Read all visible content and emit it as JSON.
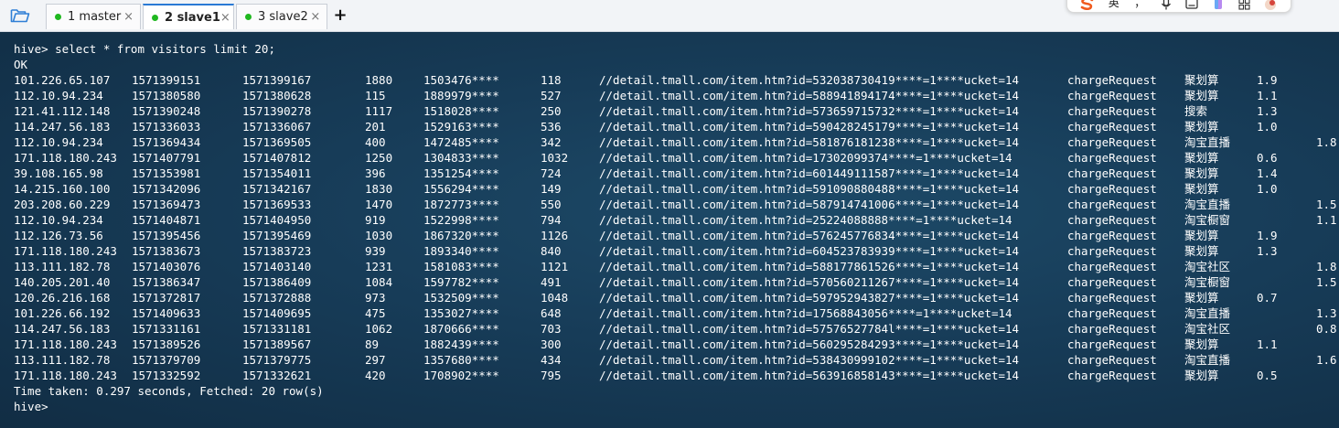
{
  "tabs": [
    {
      "label": "1 master",
      "active": false
    },
    {
      "label": "2 slave1",
      "active": true
    },
    {
      "label": "3 slave2",
      "active": false
    }
  ],
  "tab_close_glyph": "×",
  "add_tab_glyph": "+",
  "ime_toolbar": {
    "items": [
      "",
      "英",
      "，",
      "",
      "",
      "",
      "",
      ""
    ]
  },
  "terminal": {
    "command_line": "hive> select * from visitors limit 20;",
    "status_line": "OK",
    "rows": [
      [
        "101.226.65.107",
        "1571399151",
        "1571399167",
        "1880",
        "1503476****",
        "118",
        "//detail.tmall.com/item.htm?id=532038730419****=1****ucket=14",
        "chargeRequest",
        "聚划算",
        "1.9"
      ],
      [
        "112.10.94.234",
        "1571380580",
        "1571380628",
        "115",
        "1889979****",
        "527",
        "//detail.tmall.com/item.htm?id=588941894174****=1****ucket=14",
        "chargeRequest",
        "聚划算",
        "1.1"
      ],
      [
        "121.41.112.148",
        "1571390248",
        "1571390278",
        "1117",
        "1518028****",
        "250",
        "//detail.tmall.com/item.htm?id=573659715732****=1****ucket=14",
        "chargeRequest",
        "搜索",
        "1.3"
      ],
      [
        "114.247.56.183",
        "1571336033",
        "1571336067",
        "201",
        "1529163****",
        "536",
        "//detail.tmall.com/item.htm?id=590428245179****=1****ucket=14",
        "chargeRequest",
        "聚划算",
        "1.0"
      ],
      [
        "112.10.94.234",
        "1571369434",
        "1571369505",
        "400",
        "1472485****",
        "342",
        "//detail.tmall.com/item.htm?id=581876181238****=1****ucket=14",
        "chargeRequest",
        "淘宝直播",
        "1.8"
      ],
      [
        "171.118.180.243",
        "1571407791",
        "1571407812",
        "1250",
        "1304833****",
        "1032",
        "//detail.tmall.com/item.htm?id=17302099374****=1****ucket=14",
        "chargeRequest",
        "聚划算",
        "0.6"
      ],
      [
        "39.108.165.98",
        "1571353981",
        "1571354011",
        "396",
        "1351254****",
        "724",
        "//detail.tmall.com/item.htm?id=601449111587****=1****ucket=14",
        "chargeRequest",
        "聚划算",
        "1.4"
      ],
      [
        "14.215.160.100",
        "1571342096",
        "1571342167",
        "1830",
        "1556294****",
        "149",
        "//detail.tmall.com/item.htm?id=591090880488****=1****ucket=14",
        "chargeRequest",
        "聚划算",
        "1.0"
      ],
      [
        "203.208.60.229",
        "1571369473",
        "1571369533",
        "1470",
        "1872773****",
        "550",
        "//detail.tmall.com/item.htm?id=587914741006****=1****ucket=14",
        "chargeRequest",
        "淘宝直播",
        "1.5"
      ],
      [
        "112.10.94.234",
        "1571404871",
        "1571404950",
        "919",
        "1522998****",
        "794",
        "//detail.tmall.com/item.htm?id=25224088888****=1****ucket=14",
        "chargeRequest",
        "淘宝橱窗",
        "1.1"
      ],
      [
        "112.126.73.56",
        "1571395456",
        "1571395469",
        "1030",
        "1867320****",
        "1126",
        "//detail.tmall.com/item.htm?id=576245776834****=1****ucket=14",
        "chargeRequest",
        "聚划算",
        "1.9"
      ],
      [
        "171.118.180.243",
        "1571383673",
        "1571383723",
        "939",
        "1893340****",
        "840",
        "//detail.tmall.com/item.htm?id=604523783939****=1****ucket=14",
        "chargeRequest",
        "聚划算",
        "1.3"
      ],
      [
        "113.111.182.78",
        "1571403076",
        "1571403140",
        "1231",
        "1581083****",
        "1121",
        "//detail.tmall.com/item.htm?id=588177861526****=1****ucket=14",
        "chargeRequest",
        "淘宝社区",
        "1.8"
      ],
      [
        "140.205.201.40",
        "1571386347",
        "1571386409",
        "1084",
        "1597782****",
        "491",
        "//detail.tmall.com/item.htm?id=570560211267****=1****ucket=14",
        "chargeRequest",
        "淘宝橱窗",
        "1.5"
      ],
      [
        "120.26.216.168",
        "1571372817",
        "1571372888",
        "973",
        "1532509****",
        "1048",
        "//detail.tmall.com/item.htm?id=597952943827****=1****ucket=14",
        "chargeRequest",
        "聚划算",
        "0.7"
      ],
      [
        "101.226.66.192",
        "1571409633",
        "1571409695",
        "475",
        "1353027****",
        "648",
        "//detail.tmall.com/item.htm?id=17568843056****=1****ucket=14",
        "chargeRequest",
        "淘宝直播",
        "1.3"
      ],
      [
        "114.247.56.183",
        "1571331161",
        "1571331181",
        "1062",
        "1870666****",
        "703",
        "//detail.tmall.com/item.htm?id=57576527784l****=1****ucket=14",
        "chargeRequest",
        "淘宝社区",
        "0.8"
      ],
      [
        "171.118.180.243",
        "1571389526",
        "1571389567",
        "89",
        "1882439****",
        "300",
        "//detail.tmall.com/item.htm?id=560295284293****=1****ucket=14",
        "chargeRequest",
        "聚划算",
        "1.1"
      ],
      [
        "113.111.182.78",
        "1571379709",
        "1571379775",
        "297",
        "1357680****",
        "434",
        "//detail.tmall.com/item.htm?id=538430999102****=1****ucket=14",
        "chargeRequest",
        "淘宝直播",
        "1.6"
      ],
      [
        "171.118.180.243",
        "1571332592",
        "1571332621",
        "420",
        "1708902****",
        "795",
        "//detail.tmall.com/item.htm?id=563916858143****=1****ucket=14",
        "chargeRequest",
        "聚划算",
        "0.5"
      ]
    ],
    "time_taken_line": "Time taken: 0.297 seconds, Fetched: 20 row(s)",
    "prompt_line": "hive>"
  },
  "colors": {
    "terminal_text": "#ffffff",
    "active_tab_accent": "#2a7ad5",
    "tab_status_dot": "#20b820"
  }
}
